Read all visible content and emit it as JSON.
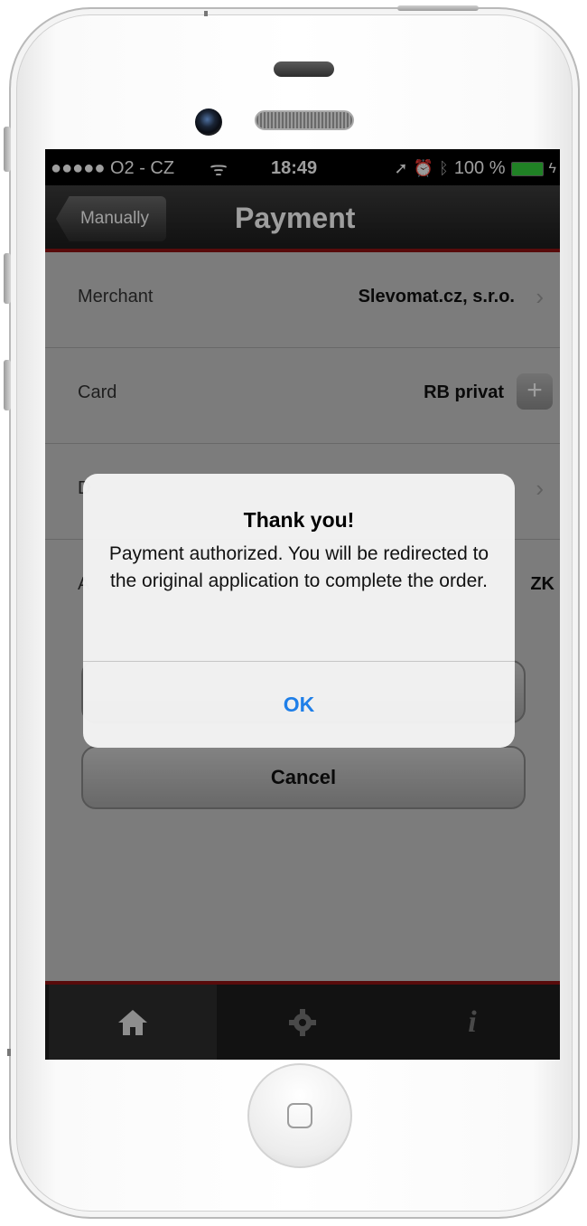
{
  "status_bar": {
    "carrier": "●●●●● O2 - CZ",
    "time": "18:49",
    "battery": "100 %"
  },
  "nav": {
    "back_label": "Manually",
    "title": "Payment"
  },
  "rows": [
    {
      "label": "Merchant",
      "value": "Slevomat.cz, s.r.o."
    },
    {
      "label": "Card",
      "value": "RB privat"
    },
    {
      "label": "D",
      "value": ""
    },
    {
      "label": "A",
      "value": "ZK"
    }
  ],
  "buttons": {
    "cancel": "Cancel"
  },
  "alert": {
    "title": "Thank you!",
    "message": "Payment authorized. You will be redirected to the original application to complete the order.",
    "ok": "OK"
  },
  "tabs": [
    {
      "icon": "home-icon",
      "active": true
    },
    {
      "icon": "gear-icon",
      "active": false
    },
    {
      "icon": "info-icon",
      "active": false
    }
  ],
  "colors": {
    "accent_red": "#8e1212",
    "ok_blue": "#1f7fe8",
    "battery_green": "#35d13d"
  }
}
